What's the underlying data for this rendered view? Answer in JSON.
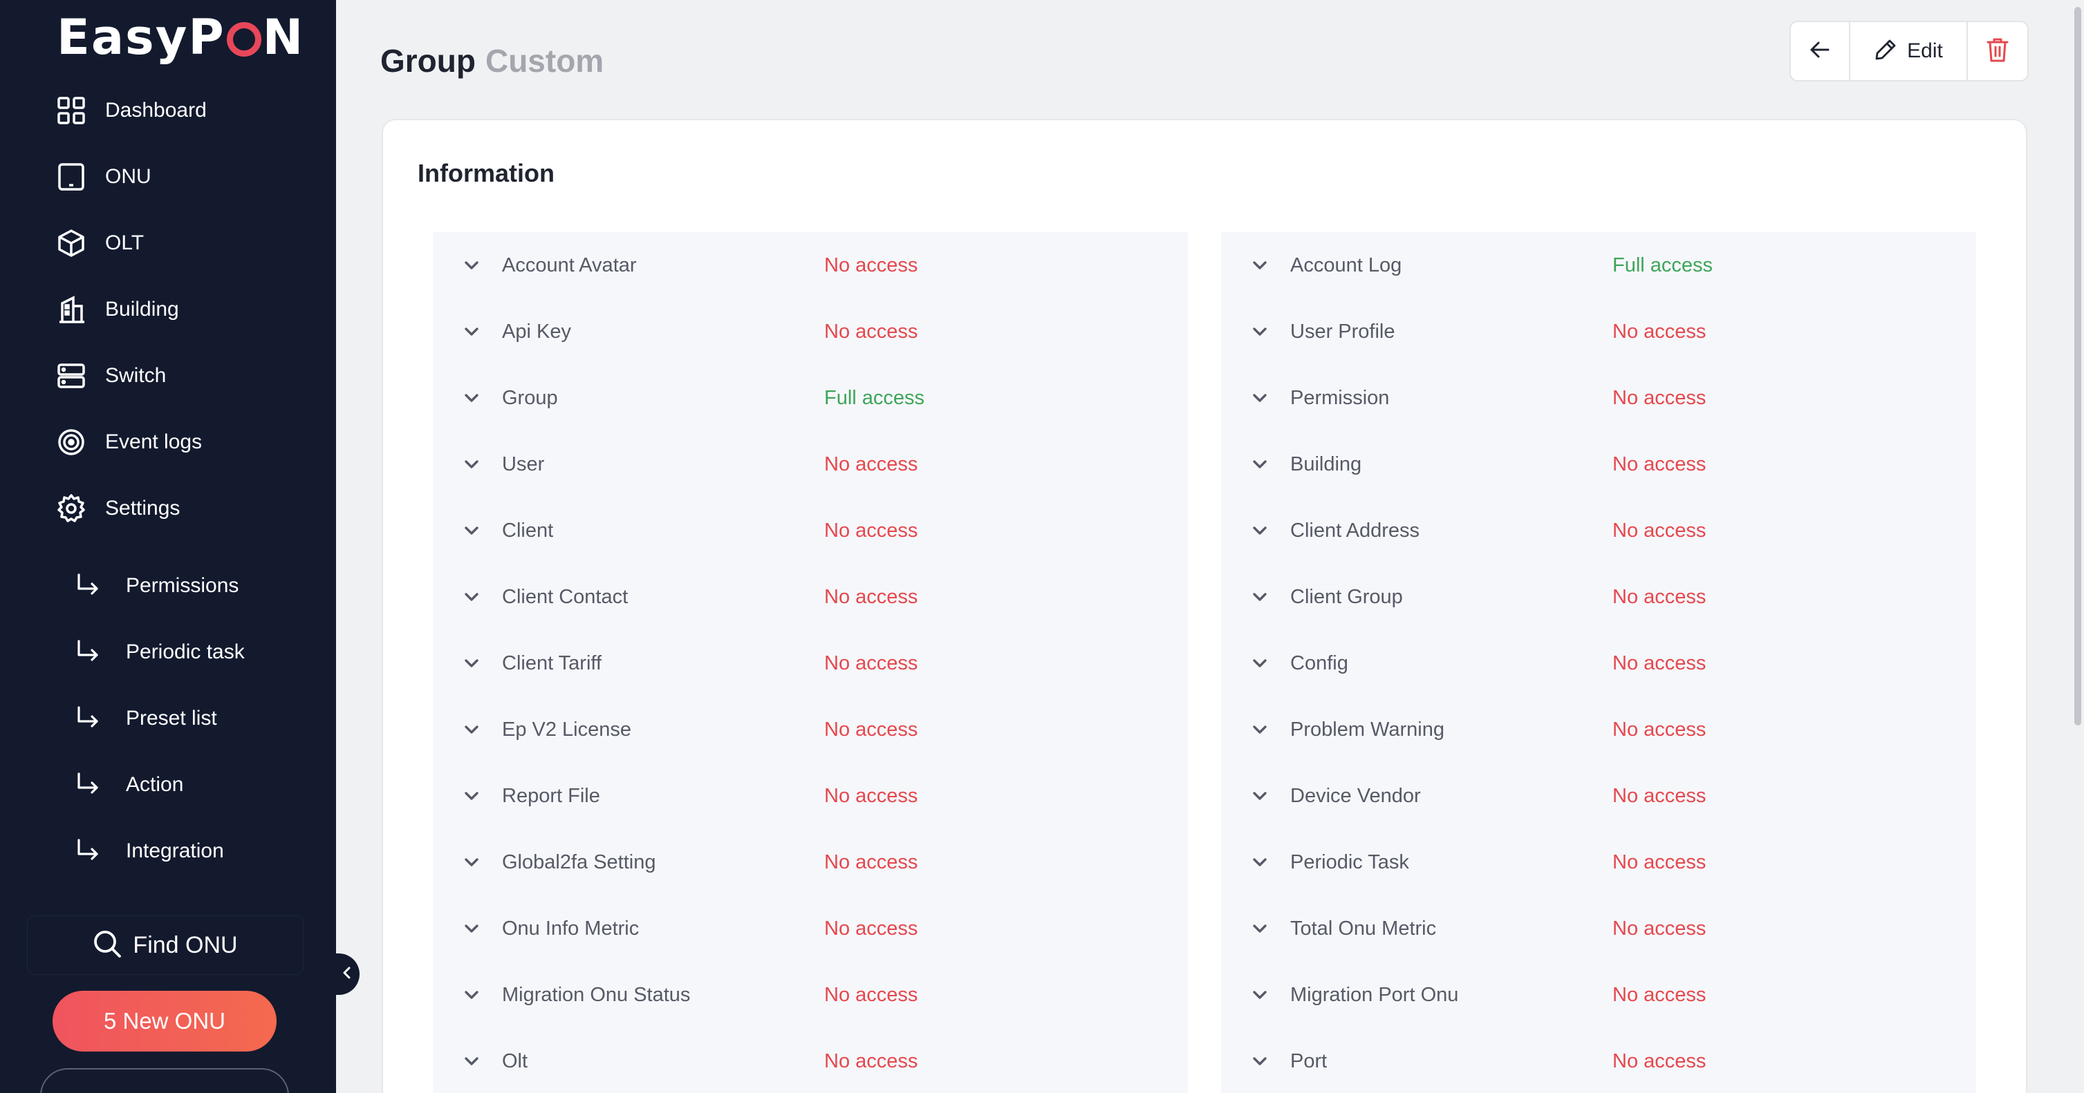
{
  "sidebar": {
    "logo": "EasyPON",
    "nav": [
      {
        "label": "Dashboard",
        "icon": "grid-icon"
      },
      {
        "label": "ONU",
        "icon": "tablet-icon"
      },
      {
        "label": "OLT",
        "icon": "cube-icon"
      },
      {
        "label": "Building",
        "icon": "building-icon"
      },
      {
        "label": "Switch",
        "icon": "server-icon"
      },
      {
        "label": "Event logs",
        "icon": "radar-icon"
      },
      {
        "label": "Settings",
        "icon": "gear-icon"
      }
    ],
    "sub_nav": [
      {
        "label": "Permissions"
      },
      {
        "label": "Periodic task"
      },
      {
        "label": "Preset list"
      },
      {
        "label": "Action"
      },
      {
        "label": "Integration"
      }
    ],
    "find_onu": "Find ONU",
    "new_onu": "5 New ONU"
  },
  "header": {
    "title": "Group",
    "subtitle": "Custom",
    "edit_label": "Edit"
  },
  "card": {
    "title": "Information",
    "left": [
      {
        "name": "Account Avatar",
        "access": "No access"
      },
      {
        "name": "Api Key",
        "access": "No access"
      },
      {
        "name": "Group",
        "access": "Full access"
      },
      {
        "name": "User",
        "access": "No access"
      },
      {
        "name": "Client",
        "access": "No access"
      },
      {
        "name": "Client Contact",
        "access": "No access"
      },
      {
        "name": "Client Tariff",
        "access": "No access"
      },
      {
        "name": "Ep V2 License",
        "access": "No access"
      },
      {
        "name": "Report File",
        "access": "No access"
      },
      {
        "name": "Global2fa Setting",
        "access": "No access"
      },
      {
        "name": "Onu Info Metric",
        "access": "No access"
      },
      {
        "name": "Migration Onu Status",
        "access": "No access"
      },
      {
        "name": "Olt",
        "access": "No access"
      }
    ],
    "right": [
      {
        "name": "Account Log",
        "access": "Full access"
      },
      {
        "name": "User Profile",
        "access": "No access"
      },
      {
        "name": "Permission",
        "access": "No access"
      },
      {
        "name": "Building",
        "access": "No access"
      },
      {
        "name": "Client Address",
        "access": "No access"
      },
      {
        "name": "Client Group",
        "access": "No access"
      },
      {
        "name": "Config",
        "access": "No access"
      },
      {
        "name": "Problem Warning",
        "access": "No access"
      },
      {
        "name": "Device Vendor",
        "access": "No access"
      },
      {
        "name": "Periodic Task",
        "access": "No access"
      },
      {
        "name": "Total Onu Metric",
        "access": "No access"
      },
      {
        "name": "Migration Port Onu",
        "access": "No access"
      },
      {
        "name": "Port",
        "access": "No access"
      }
    ]
  },
  "colors": {
    "sidebar_bg": "#131a2e",
    "no_access": "#e5484d",
    "full_access": "#3ea55a",
    "accent": "#f0545e"
  }
}
